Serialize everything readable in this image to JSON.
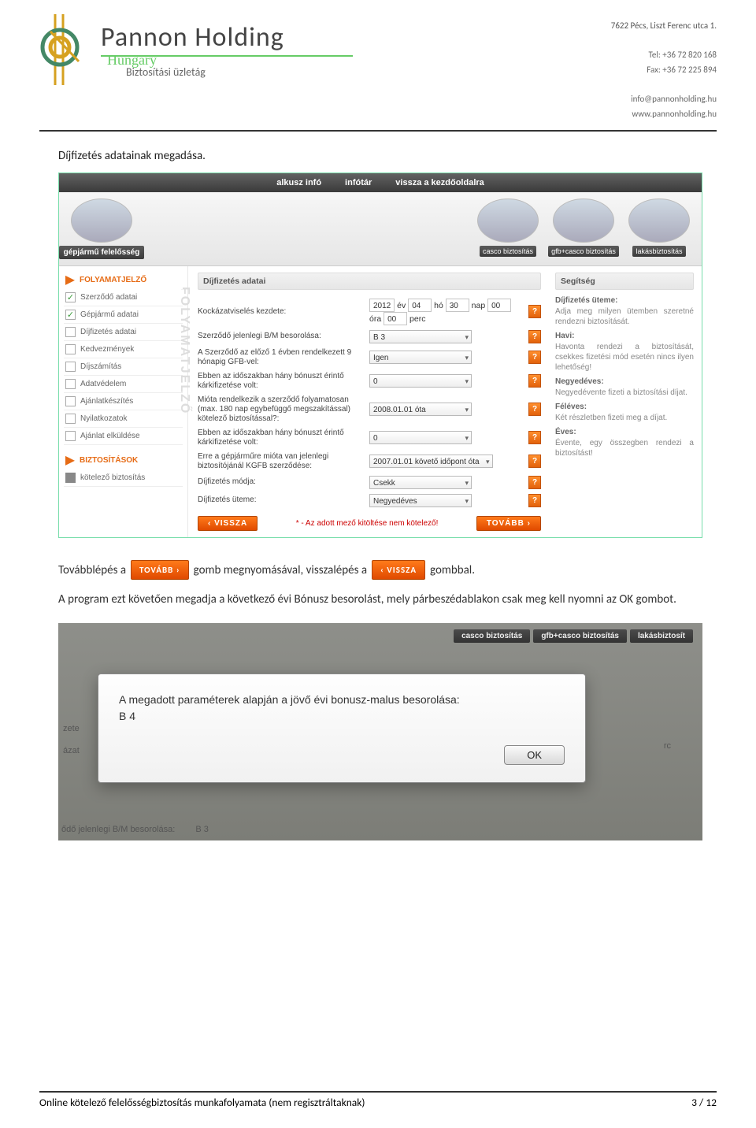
{
  "header": {
    "company": "Pannon Holding",
    "sub1": "Hungary",
    "sub2": "Biztosítási üzletág",
    "contact": {
      "address": "7622 Pécs, Liszt Ferenc utca 1.",
      "tel": "Tel: +36 72 820 168",
      "fax": "Fax: +36 72 225 894",
      "email": "info@pannonholding.hu",
      "web": "www.pannonholding.hu"
    }
  },
  "body": {
    "p1": "Díjfizetés adatainak megadása.",
    "p2_pre": "Továbblépés a",
    "p2_mid": "gomb megnyomásával, visszalépés a",
    "p2_post": "gombbal.",
    "btn_tovabb": "TOVÁBB  ›",
    "btn_vissza": "‹  VISSZA",
    "p3": "A program ezt követően megadja a következő évi Bónusz besorolást, mely párbeszédablakon csak meg kell nyomni az OK gombot."
  },
  "shot1": {
    "nav": [
      "alkusz infó",
      "infótár",
      "vissza a kezdőoldalra"
    ],
    "left_card": "gépjármű felelősség",
    "right_cards": [
      "casco biztosítás",
      "gfb+casco biztosítás",
      "lakásbiztosítás"
    ],
    "sidebar": {
      "sec1": "FOLYAMATJELZŐ",
      "items": [
        {
          "label": "Szerződő adatai",
          "checked": true
        },
        {
          "label": "Gépjármű adatai",
          "checked": true
        },
        {
          "label": "Díjfizetés adatai",
          "checked": false
        },
        {
          "label": "Kedvezmények",
          "checked": false
        },
        {
          "label": "Díjszámítás",
          "checked": false
        },
        {
          "label": "Adatvédelem",
          "checked": false
        },
        {
          "label": "Ajánlatkészítés",
          "checked": false
        },
        {
          "label": "Nyilatkozatok",
          "checked": false
        },
        {
          "label": "Ajánlat elküldése",
          "checked": false
        }
      ],
      "sec2": "BIZTOSÍTÁSOK",
      "sec2_item": "kötelező biztosítás",
      "watermark": "FOLYAMATJELZŐ"
    },
    "form": {
      "panel_title": "Díjfizetés adatai",
      "rows": [
        {
          "label": "Kockázatviselés kezdete:",
          "type": "date",
          "y": "2012",
          "ylab": "év",
          "m": "04",
          "mlab": "hó",
          "d": "30",
          "dlab": "nap",
          "h": "00",
          "hlab": "óra",
          "p": "00",
          "plab": "perc"
        },
        {
          "label": "Szerződő jelenlegi B/M besorolása:",
          "type": "select",
          "value": "B 3"
        },
        {
          "label": "A Szerződő az előző 1 évben rendelkezett 9 hónapig GFB-vel:",
          "type": "select",
          "value": "Igen"
        },
        {
          "label": "Ebben az időszakban hány bónuszt érintő kárkifizetése volt:",
          "type": "select",
          "value": "0"
        },
        {
          "label": "Mióta rendelkezik a szerződő folyamatosan (max. 180 nap egybefüggő megszakítással) kötelező biztosítással?:",
          "type": "select",
          "value": "2008.01.01 óta"
        },
        {
          "label": "Ebben az időszakban hány bónuszt érintő kárkifizetése volt:",
          "type": "select",
          "value": "0"
        },
        {
          "label": "Erre a gépjárműre mióta van jelenlegi biztosítójánál KGFB szerződése:",
          "type": "select",
          "value": "2007.01.01 követő időpont óta"
        },
        {
          "label": "Díjfizetés módja:",
          "type": "select",
          "value": "Csekk"
        },
        {
          "label": "Díjfizetés üteme:",
          "type": "select",
          "value": "Negyedéves"
        }
      ],
      "note": "* - Az adott mező kitöltése nem kötelező!",
      "back": "‹  VISSZA",
      "next": "TOVÁBB  ›"
    },
    "help": {
      "title": "Segítség",
      "h0": "Díjfizetés üteme:",
      "p0": "Adja meg milyen ütemben szeretné rendezni biztosítását.",
      "h1": "Havi:",
      "p1": "Havonta rendezi a biztosítását, csekkes fizetési mód esetén nincs ilyen lehetőség!",
      "h2": "Negyedéves:",
      "p2": "Negyedévente fizeti a biztosítási díjat.",
      "h3": "Féléves:",
      "p3": "Két részletben fizeti meg a díjat.",
      "h4": "Éves:",
      "p4": "Évente, egy összegben rendezi a biztosítást!"
    }
  },
  "shot2": {
    "tabs": [
      "casco biztosítás",
      "gfb+casco biztosítás",
      "lakásbiztosít"
    ],
    "left": [
      "zete",
      "ázat"
    ],
    "behind_label": "ődő jelenlegi B/M besorolása:",
    "behind_val": "B 3",
    "rc_label": "rc",
    "dialog": {
      "msg": "A megadott paraméterek alapján a jövő évi bonusz-malus besorolása:",
      "val": "B 4",
      "ok": "OK"
    }
  },
  "footer": {
    "left": "Online kötelező felelősségbiztosítás munkafolyamata (nem regisztráltaknak)",
    "right": "3 / 12"
  }
}
